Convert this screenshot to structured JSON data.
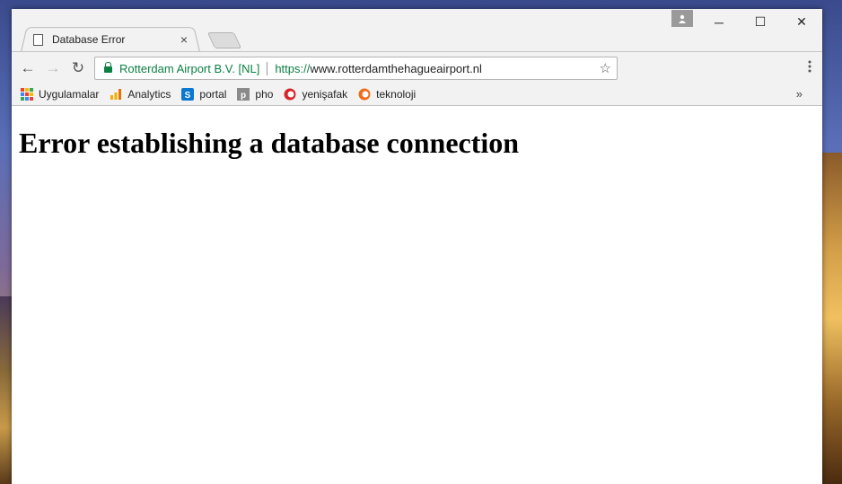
{
  "tab": {
    "title": "Database Error",
    "close": "×"
  },
  "toolbar": {
    "back": "←",
    "forward": "→",
    "reload": "↻",
    "ev_cert": "Rotterdam Airport B.V. [NL]",
    "url_scheme": "https://",
    "url_host": "www.rotterdamthehagueairport.nl",
    "star": "☆",
    "menu": "⋮"
  },
  "window_controls": {
    "minimize": "─",
    "maximize": "☐",
    "close": "✕"
  },
  "bookmarks": [
    {
      "label": "Uygulamalar",
      "icon": "apps-grid-icon"
    },
    {
      "label": "Analytics",
      "icon": "analytics-icon"
    },
    {
      "label": "portal",
      "icon": "sharepoint-icon"
    },
    {
      "label": "pho",
      "icon": "p-icon"
    },
    {
      "label": "yenişafak",
      "icon": "yenisafak-icon"
    },
    {
      "label": "teknoloji",
      "icon": "teknoloji-icon"
    }
  ],
  "bookmarks_more": "»",
  "page": {
    "heading": "Error establishing a database connection"
  },
  "colors": {
    "secure_green": "#0b8043",
    "chrome_bg": "#f2f2f2"
  }
}
